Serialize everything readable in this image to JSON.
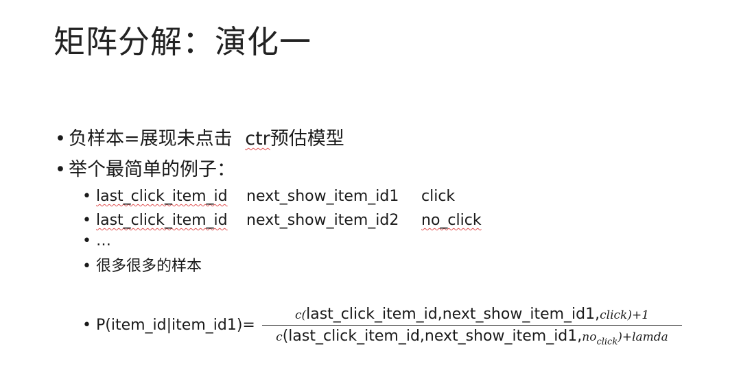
{
  "title": "矩阵分解：演化一",
  "bullets": {
    "b1": {
      "marker": "•",
      "text": "负样本=展现未点击",
      "ctr": "ctr",
      "rest": "预估模型"
    },
    "b2": {
      "marker": "•",
      "text": "举个最简单的例子："
    }
  },
  "sub_bullets": [
    {
      "marker": "•",
      "c1": "last_click_item_id",
      "c2": "next_show_item_id1",
      "c3": "click"
    },
    {
      "marker": "•",
      "c1": "last_click_item_id",
      "c2": "next_show_item_id2",
      "c3": "no_click"
    },
    {
      "marker": "•",
      "text": "…"
    },
    {
      "marker": "•",
      "text": "很多很多的样本"
    }
  ],
  "formula": {
    "marker": "•",
    "lhs": "P(item_id|item_id1)=",
    "numerator": {
      "c": "c",
      "open": "(",
      "args": "last_click_item_id,next_show_item_id1,",
      "label": "click",
      "close": ")+1"
    },
    "denominator": {
      "c": "c",
      "args": "(last_click_item_id,next_show_item_id1,",
      "label": "no",
      "label_sub": "click",
      "close": ")+lamda"
    }
  }
}
